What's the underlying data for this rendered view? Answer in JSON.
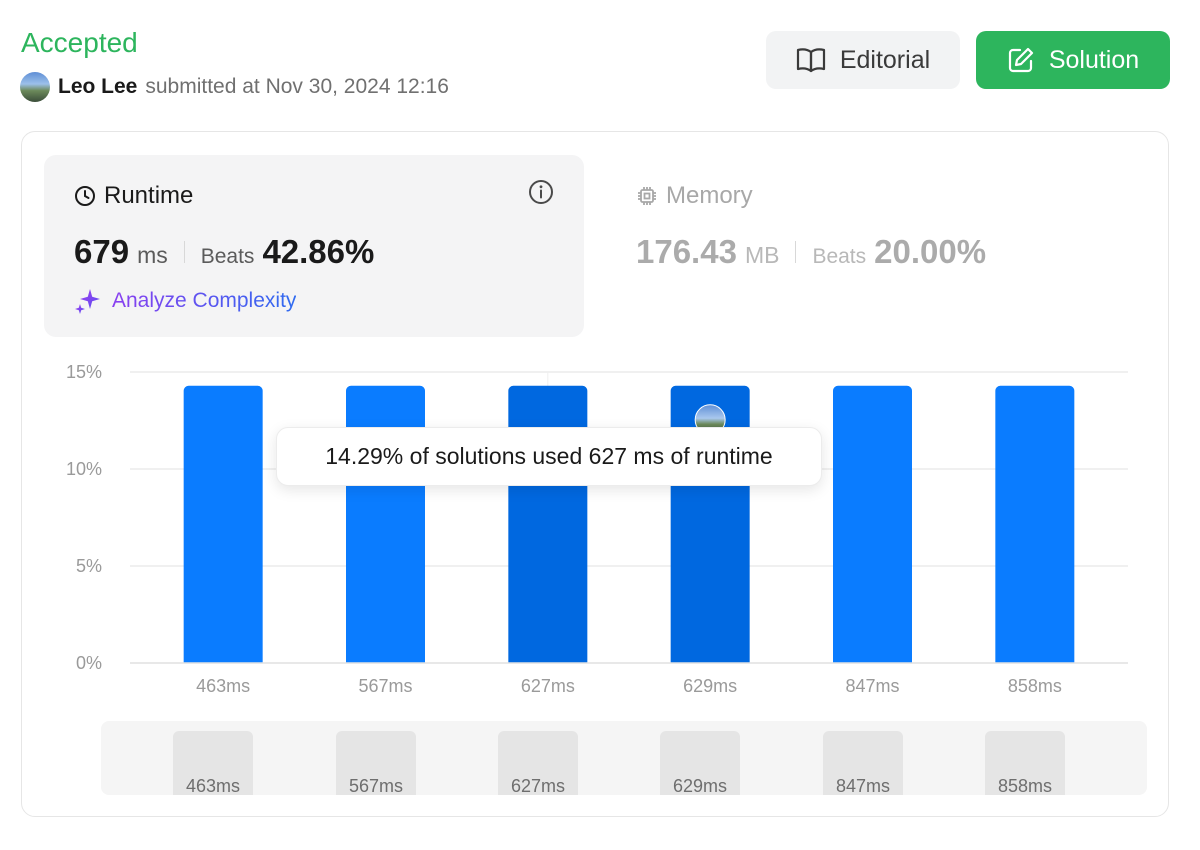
{
  "header": {
    "status": "Accepted",
    "user_name": "Leo Lee",
    "submitted_text": "submitted at Nov 30, 2024 12:16",
    "editorial_label": "Editorial",
    "solution_label": "Solution"
  },
  "runtime": {
    "title": "Runtime",
    "value": "679",
    "unit": "ms",
    "beats_label": "Beats",
    "beats_value": "42.86%",
    "analyze_label": "Analyze Complexity"
  },
  "memory": {
    "title": "Memory",
    "value": "176.43",
    "unit": "MB",
    "beats_label": "Beats",
    "beats_value": "20.00%"
  },
  "tooltip_text": "14.29% of solutions used 627 ms of runtime",
  "colors": {
    "accepted_green": "#2db55d",
    "bar_blue": "#0a7cff",
    "bar_blue_selected": "#0068e0"
  },
  "chart_data": {
    "type": "bar",
    "categories": [
      "463ms",
      "567ms",
      "627ms",
      "629ms",
      "847ms",
      "858ms"
    ],
    "values": [
      14.29,
      14.29,
      14.29,
      14.29,
      14.29,
      14.29
    ],
    "y_ticks": [
      "0%",
      "5%",
      "10%",
      "15%"
    ],
    "ylim": [
      0,
      15
    ],
    "highlighted": [
      "627ms",
      "629ms"
    ],
    "user_marker_category": "629ms",
    "grid": true
  },
  "mini_labels": [
    "463ms",
    "567ms",
    "627ms",
    "629ms",
    "847ms",
    "858ms"
  ]
}
